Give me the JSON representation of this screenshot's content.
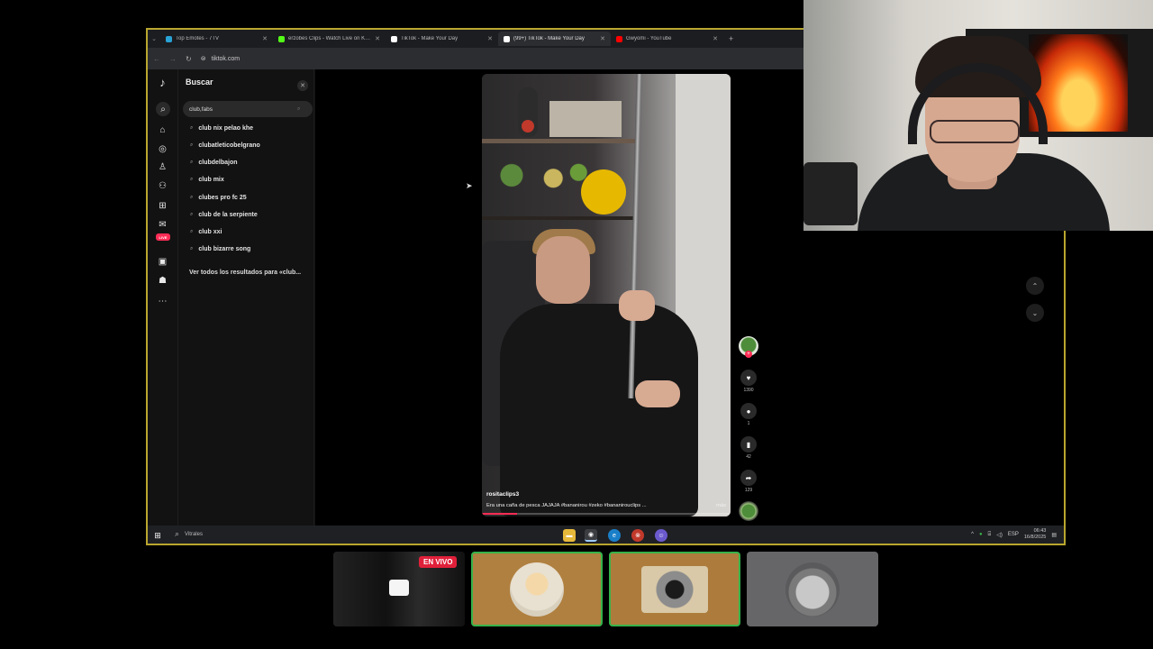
{
  "browser": {
    "tabs": [
      {
        "label": "Top Emotes - 7TV",
        "color": "#29a3d6",
        "active": false
      },
      {
        "label": "erzobes Clips - Watch Live on Kick",
        "color": "#53fc18",
        "active": false
      },
      {
        "label": "TikTok - Make Your Day",
        "color": "#ffffff",
        "active": false
      },
      {
        "label": "(99+) TikTok - Make Your Day",
        "color": "#ffffff",
        "active": true
      },
      {
        "label": "Gwyomi - YouTube",
        "color": "#ff0000",
        "active": false
      }
    ],
    "url": "tiktok.com",
    "new_tab": "+"
  },
  "tiktok": {
    "search_title": "Buscar",
    "search_value": "club,fabs",
    "suggestions": [
      "club nix pelao khe",
      "clubatleticobelgrano",
      "clubdelbajon",
      "club mix",
      "clubes pro fc 25",
      "club de la serpiente",
      "club xxi",
      "club bizarre song"
    ],
    "see_all": "Ver todos los resultados para «club...",
    "video": {
      "author": "rositaclips3",
      "caption": "Era una caña de pesca JAJAJA #bananirou #zeko #bananirouclips ...",
      "more": "más",
      "progress": 0.14
    },
    "actions": {
      "likes": "1390",
      "comments": "1",
      "saves": "42",
      "shares": "129"
    },
    "live_badge_rail": "LIVE"
  },
  "taskbar": {
    "search_text": "Vitrales",
    "lang": "ESP",
    "time": "06:43",
    "date": "16/8/2025"
  },
  "streams": {
    "live_badge": "EN VIVO"
  }
}
